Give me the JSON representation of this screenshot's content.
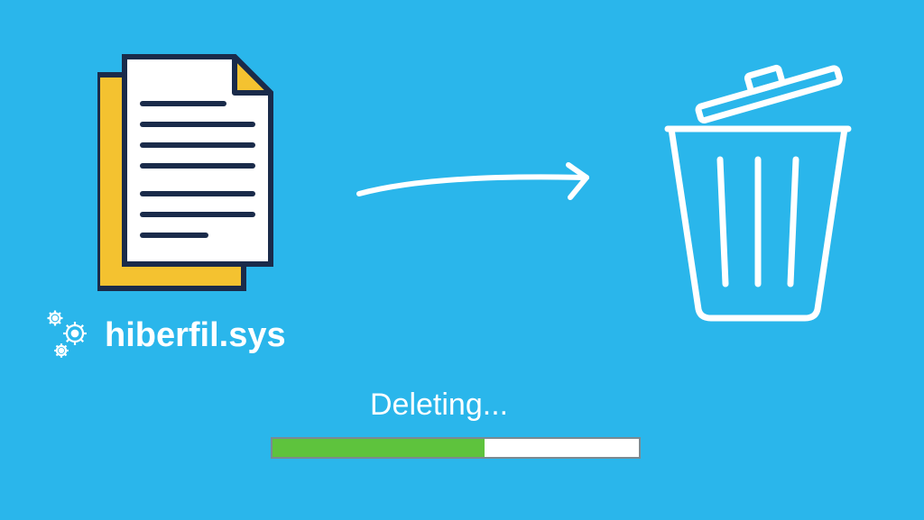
{
  "filename": "hiberfil.sys",
  "status_text": "Deleting...",
  "progress_percent": 58,
  "colors": {
    "bg": "#2ab6eb",
    "document_stroke": "#1a2b4a",
    "document_fill": "#ffffff",
    "document_back": "#f4c230",
    "fold_fill": "#f4c230",
    "text": "#ffffff",
    "progress_green": "#5ec33d",
    "progress_border": "#7a8a92",
    "arrow": "#ffffff",
    "trash": "#ffffff"
  },
  "icons": {
    "document": "document-stack-icon",
    "gears": "gears-icon",
    "arrow": "arrow-right-icon",
    "trash": "trash-open-lid-icon"
  }
}
